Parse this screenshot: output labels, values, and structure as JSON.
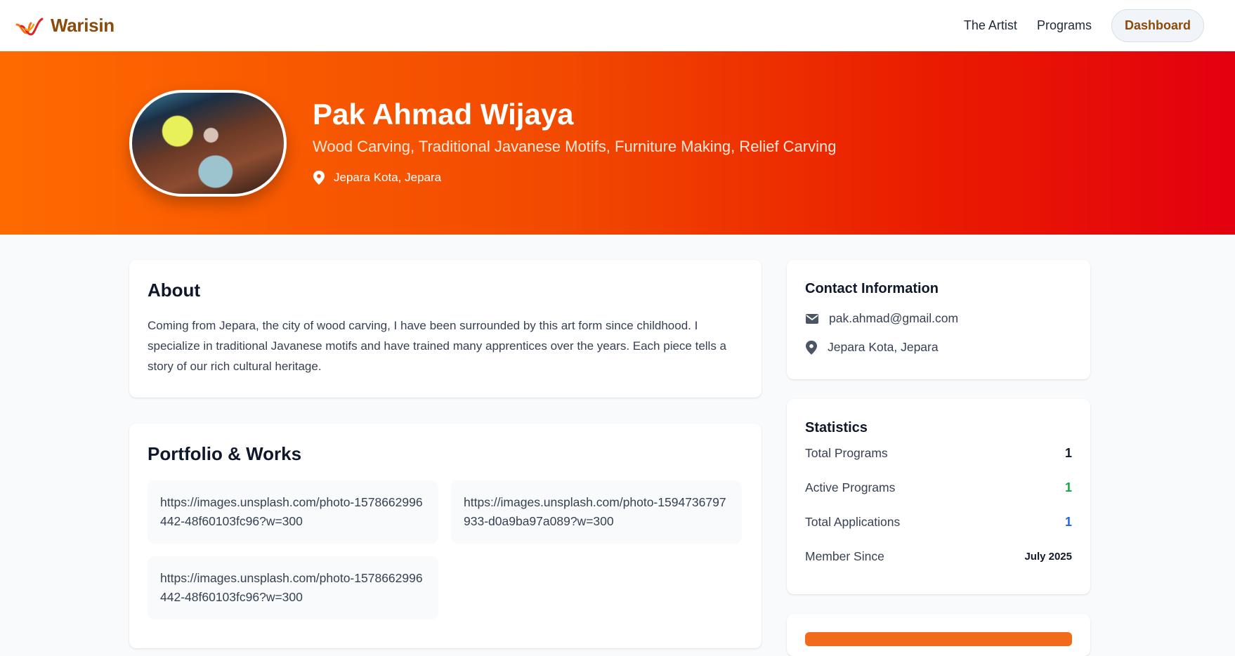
{
  "nav": {
    "brand": "Warisin",
    "links": [
      "The Artist",
      "Programs"
    ],
    "dashboard": "Dashboard"
  },
  "hero": {
    "name": "Pak Ahmad Wijaya",
    "skills": "Wood Carving, Traditional Javanese Motifs, Furniture Making, Relief Carving",
    "location": "Jepara Kota, Jepara"
  },
  "about": {
    "title": "About",
    "text": "Coming from Jepara, the city of wood carving, I have been surrounded by this art form since childhood. I specialize in traditional Javanese motifs and have trained many apprentices over the years. Each piece tells a story of our rich cultural heritage."
  },
  "portfolio": {
    "title": "Portfolio & Works",
    "items": [
      "https://images.unsplash.com/photo-1578662996442-48f60103fc96?w=300",
      "https://images.unsplash.com/photo-1594736797933-d0a9ba97a089?w=300",
      "https://images.unsplash.com/photo-1578662996442-48f60103fc96?w=300"
    ]
  },
  "contact": {
    "title": "Contact Information",
    "email": "pak.ahmad@gmail.com",
    "location": "Jepara Kota, Jepara"
  },
  "stats": {
    "title": "Statistics",
    "rows": [
      {
        "label": "Total Programs",
        "value": "1",
        "color": "#111827"
      },
      {
        "label": "Active Programs",
        "value": "1",
        "color": "#16a34a"
      },
      {
        "label": "Total Applications",
        "value": "1",
        "color": "#2563eb"
      },
      {
        "label": "Member Since",
        "value": "July 2025",
        "color": "#111827"
      }
    ]
  },
  "colors": {
    "brand": "#8a4b0b",
    "hero_start": "#ff6a00",
    "hero_end": "#e3000f",
    "accent_button": "#f26b1d"
  },
  "icons": {
    "logo": "warisin-logo-icon",
    "location": "map-pin-icon",
    "email": "mail-icon"
  }
}
